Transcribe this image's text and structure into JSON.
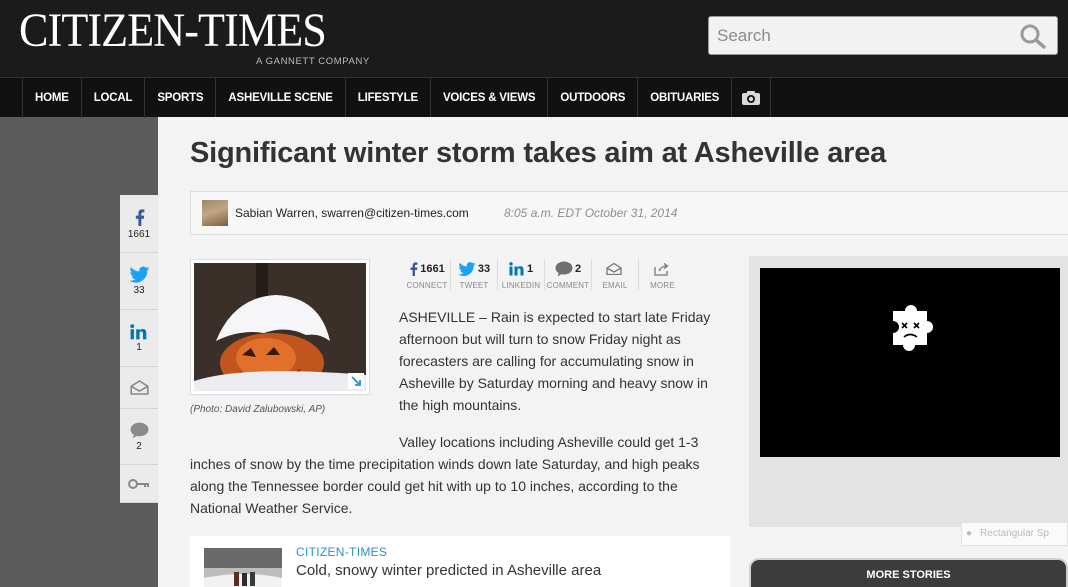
{
  "header": {
    "logo": "CITIZEN-TIMES",
    "logo_sub": "A GANNETT COMPANY",
    "search_placeholder": "Search"
  },
  "nav": {
    "items": [
      "HOME",
      "LOCAL",
      "SPORTS",
      "ASHEVILLE SCENE",
      "LIFESTYLE",
      "VOICES & VIEWS",
      "OUTDOORS",
      "OBITUARIES"
    ],
    "camera_icon": "camera-icon"
  },
  "rail": {
    "facebook_count": "1661",
    "twitter_count": "33",
    "linkedin_count": "1",
    "comments_count": "2"
  },
  "article": {
    "headline": "Significant winter storm takes aim at Asheville area",
    "author": "Sabian Warren, swarren@citizen-times.com",
    "timestamp": "8:05 a.m. EDT October 31, 2014",
    "caption": "(Photo: David Zalubowski, AP)",
    "para1": "ASHEVILLE – Rain is expected to start late Friday afternoon but will turn to snow Friday night as forecasters are calling for accumulating snow in Asheville by Saturday morning and heavy snow in the high mountains.",
    "para2": "Valley locations including Asheville could get 1-3 inches of snow by the time precipitation winds down late Saturday, and high peaks along the Tennessee border could get hit with up to 10 inches, according to the National Weather Service."
  },
  "share": [
    {
      "count": "1661",
      "label": "CONNECT",
      "icon": "facebook-icon"
    },
    {
      "count": "33",
      "label": "TWEET",
      "icon": "twitter-icon"
    },
    {
      "count": "1",
      "label": "LINKEDIN",
      "icon": "linkedin-icon"
    },
    {
      "count": "2",
      "label": "COMMENT",
      "icon": "comment-icon"
    },
    {
      "count": "",
      "label": "EMAIL",
      "icon": "email-icon"
    },
    {
      "count": "",
      "label": "MORE",
      "icon": "share-icon"
    }
  ],
  "related": {
    "kicker": "CITIZEN-TIMES",
    "title": "Cold, snowy winter predicted in Asheville area"
  },
  "ad": {
    "label": "Rectangular Sp"
  },
  "more_stories": "MORE STORIES",
  "colors": {
    "accent_blue": "#2b8fd0",
    "header_bg": "#1b1b1b",
    "nav_bg": "#111111"
  }
}
